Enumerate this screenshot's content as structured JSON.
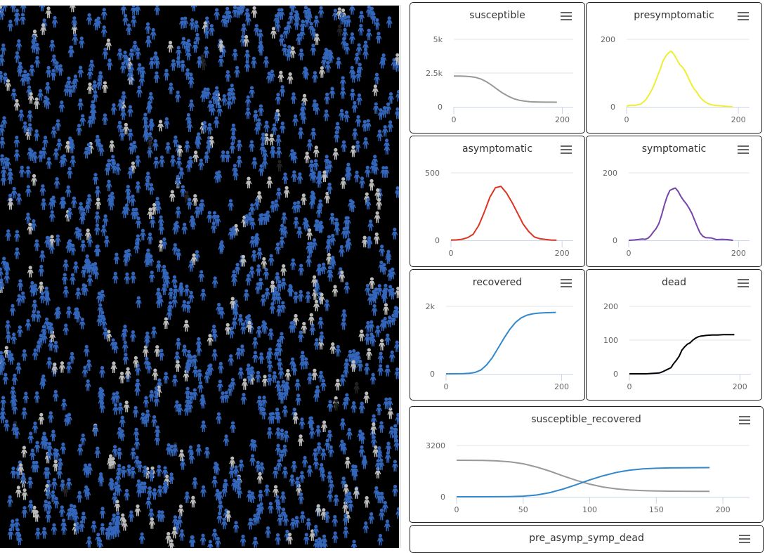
{
  "simulation": {
    "name": "agent-simulation-view",
    "colors": {
      "background": "#000000",
      "susceptible": "#3366bb",
      "recovered": "#bbbbbb",
      "dead": "#222222"
    }
  },
  "chart_data": [
    {
      "id": "susceptible",
      "type": "line",
      "title": "susceptible",
      "menu_icon": "hamburger-menu-icon",
      "xlim": [
        0,
        220
      ],
      "ylim": [
        0,
        5000
      ],
      "xticks": [
        0,
        200
      ],
      "xtick_labels": [
        "0",
        "200"
      ],
      "yticks": [
        0,
        2500,
        5000
      ],
      "ytick_labels": [
        "0",
        "2.5k",
        "5k"
      ],
      "grid": true,
      "series": [
        {
          "name": "susceptible",
          "color": "#999999",
          "x": [
            0,
            10,
            20,
            30,
            40,
            50,
            60,
            70,
            80,
            90,
            100,
            110,
            120,
            130,
            140,
            150,
            160,
            170,
            180,
            190
          ],
          "values": [
            2280,
            2275,
            2265,
            2240,
            2180,
            2060,
            1860,
            1600,
            1300,
            1020,
            790,
            610,
            490,
            420,
            380,
            360,
            350,
            345,
            342,
            340
          ]
        }
      ]
    },
    {
      "id": "presymptomatic",
      "type": "line",
      "title": "presymptomatic",
      "menu_icon": "hamburger-menu-icon",
      "xlim": [
        0,
        220
      ],
      "ylim": [
        0,
        200
      ],
      "xticks": [
        0,
        200
      ],
      "xtick_labels": [
        "0",
        "200"
      ],
      "yticks": [
        0,
        200
      ],
      "ytick_labels": [
        "0",
        "200"
      ],
      "grid": true,
      "series": [
        {
          "name": "presymptomatic",
          "color": "#eeee33",
          "x": [
            0,
            5,
            10,
            15,
            20,
            25,
            30,
            35,
            40,
            45,
            50,
            55,
            60,
            65,
            70,
            75,
            80,
            85,
            90,
            95,
            100,
            105,
            110,
            115,
            120,
            125,
            130,
            135,
            140,
            145,
            150,
            155,
            160,
            170,
            180,
            190
          ],
          "values": [
            2,
            4,
            5,
            4,
            6,
            8,
            14,
            22,
            35,
            50,
            68,
            90,
            110,
            135,
            150,
            160,
            165,
            155,
            140,
            125,
            118,
            105,
            88,
            70,
            55,
            45,
            32,
            22,
            15,
            10,
            7,
            5,
            4,
            3,
            1,
            0
          ]
        }
      ]
    },
    {
      "id": "asymptomatic",
      "type": "line",
      "title": "asymptomatic",
      "menu_icon": "hamburger-menu-icon",
      "xlim": [
        0,
        220
      ],
      "ylim": [
        0,
        500
      ],
      "xticks": [
        0,
        200
      ],
      "xtick_labels": [
        "0",
        "200"
      ],
      "yticks": [
        0,
        500
      ],
      "ytick_labels": [
        "0",
        "500"
      ],
      "grid": true,
      "series": [
        {
          "name": "asymptomatic",
          "color": "#dd3322",
          "x": [
            0,
            10,
            20,
            30,
            40,
            50,
            60,
            70,
            80,
            90,
            100,
            110,
            120,
            130,
            140,
            150,
            160,
            170,
            180,
            190
          ],
          "values": [
            2,
            3,
            8,
            20,
            45,
            110,
            210,
            320,
            390,
            400,
            350,
            280,
            200,
            120,
            65,
            25,
            12,
            6,
            2,
            1
          ]
        }
      ]
    },
    {
      "id": "symptomatic",
      "type": "line",
      "title": "symptomatic",
      "menu_icon": "hamburger-menu-icon",
      "xlim": [
        0,
        220
      ],
      "ylim": [
        0,
        200
      ],
      "xticks": [
        0,
        200
      ],
      "xtick_labels": [
        "0",
        "200"
      ],
      "yticks": [
        0,
        200
      ],
      "ytick_labels": [
        "0",
        "200"
      ],
      "grid": true,
      "series": [
        {
          "name": "symptomatic",
          "color": "#7744aa",
          "x": [
            0,
            10,
            20,
            25,
            30,
            35,
            40,
            45,
            50,
            55,
            60,
            65,
            70,
            75,
            80,
            85,
            90,
            95,
            100,
            105,
            110,
            115,
            120,
            125,
            130,
            135,
            140,
            150,
            160,
            170,
            180,
            190
          ],
          "values": [
            0,
            1,
            3,
            4,
            3,
            6,
            14,
            25,
            35,
            50,
            75,
            105,
            130,
            148,
            152,
            155,
            145,
            130,
            118,
            108,
            95,
            80,
            60,
            40,
            22,
            12,
            8,
            7,
            2,
            3,
            2,
            0
          ]
        }
      ]
    },
    {
      "id": "recovered",
      "type": "line",
      "title": "recovered",
      "menu_icon": "hamburger-menu-icon",
      "xlim": [
        0,
        220
      ],
      "ylim": [
        0,
        2000
      ],
      "xticks": [
        0,
        200
      ],
      "xtick_labels": [
        "0",
        "200"
      ],
      "yticks": [
        0,
        2000
      ],
      "ytick_labels": [
        "0",
        "2k"
      ],
      "grid": true,
      "series": [
        {
          "name": "recovered",
          "color": "#3388cc",
          "x": [
            0,
            10,
            20,
            30,
            40,
            50,
            60,
            70,
            80,
            90,
            100,
            110,
            120,
            130,
            140,
            150,
            160,
            170,
            180,
            190
          ],
          "values": [
            0,
            0,
            2,
            5,
            15,
            40,
            110,
            260,
            480,
            760,
            1050,
            1310,
            1520,
            1660,
            1740,
            1780,
            1800,
            1810,
            1815,
            1820
          ]
        }
      ]
    },
    {
      "id": "dead",
      "type": "line",
      "title": "dead",
      "menu_icon": "hamburger-menu-icon",
      "xlim": [
        0,
        220
      ],
      "ylim": [
        0,
        200
      ],
      "xticks": [
        0,
        200
      ],
      "xtick_labels": [
        "0",
        "200"
      ],
      "yticks": [
        0,
        100,
        200
      ],
      "ytick_labels": [
        "0",
        "100",
        "200"
      ],
      "grid": true,
      "series": [
        {
          "name": "dead",
          "color": "#000000",
          "x": [
            0,
            10,
            20,
            30,
            40,
            50,
            55,
            60,
            65,
            70,
            75,
            80,
            85,
            90,
            95,
            100,
            105,
            110,
            115,
            120,
            125,
            130,
            135,
            140,
            150,
            160,
            170,
            180,
            190
          ],
          "values": [
            0,
            0,
            0,
            0,
            1,
            2,
            3,
            6,
            10,
            14,
            18,
            30,
            40,
            52,
            70,
            80,
            88,
            92,
            100,
            106,
            110,
            112,
            113,
            114,
            115,
            115,
            116,
            116,
            116
          ]
        }
      ]
    },
    {
      "id": "susceptible_recovered",
      "type": "line",
      "title": "susceptible_recovered",
      "menu_icon": "hamburger-menu-icon",
      "xlim": [
        0,
        220
      ],
      "ylim": [
        0,
        3200
      ],
      "xticks": [
        0,
        50,
        100,
        150,
        200
      ],
      "xtick_labels": [
        "0",
        "50",
        "100",
        "150",
        "200"
      ],
      "yticks": [
        0,
        3200
      ],
      "ytick_labels": [
        "0",
        "3200"
      ],
      "grid": true,
      "series": [
        {
          "name": "susceptible",
          "color": "#999999",
          "x": [
            0,
            10,
            20,
            30,
            40,
            50,
            60,
            70,
            80,
            90,
            100,
            110,
            120,
            130,
            140,
            150,
            160,
            170,
            180,
            190
          ],
          "values": [
            2280,
            2275,
            2265,
            2240,
            2180,
            2060,
            1860,
            1600,
            1300,
            1020,
            790,
            610,
            490,
            420,
            380,
            360,
            350,
            345,
            342,
            340
          ]
        },
        {
          "name": "recovered",
          "color": "#3388cc",
          "x": [
            0,
            10,
            20,
            30,
            40,
            50,
            60,
            70,
            80,
            90,
            100,
            110,
            120,
            130,
            140,
            150,
            160,
            170,
            180,
            190
          ],
          "values": [
            0,
            0,
            2,
            5,
            15,
            40,
            110,
            260,
            480,
            760,
            1050,
            1310,
            1520,
            1660,
            1740,
            1780,
            1800,
            1810,
            1815,
            1820
          ]
        }
      ]
    },
    {
      "id": "pre_asymp_symp_dead",
      "type": "line",
      "title": "pre_asymp_symp_dead",
      "menu_icon": "hamburger-menu-icon",
      "series": []
    }
  ]
}
